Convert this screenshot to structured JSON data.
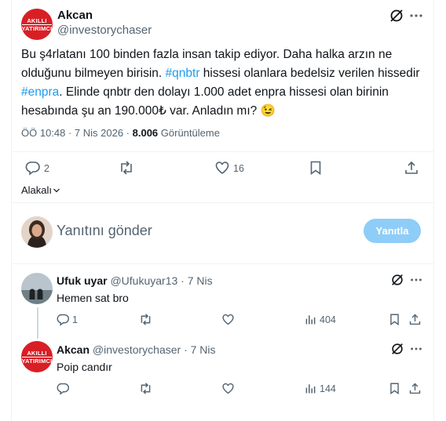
{
  "main_post": {
    "author_name": "Akcan",
    "author_handle": "@investorychaser",
    "avatar_text_1": "AKILLI",
    "avatar_text_2": "YATIRIMCI",
    "text_1": "Bu ş4rlatanı 100 binden fazla insan takip ediyor. Daha halka arzın ne",
    "text_2a": "olduğunu bilmeyen birisin. ",
    "hashtag_1": "#qnbtr",
    "text_2b": " hissesi olanlara bedelsiz verilen hissedir",
    "hashtag_2": "#enpra",
    "text_3b": ". Elinde qnbtr den dolayı 1.000 adet enpra hissesi olan birinin",
    "text_4": "hesabında şu an 190.000₺ var. Anladın mı? 😉",
    "time": "ÖÖ 10:48 · 7 Nis 2026 · ",
    "views_count": "8.006",
    "views_label": " Görüntüleme",
    "reply_count": "2",
    "like_count": "16"
  },
  "translate_label": "Alakalı",
  "composer": {
    "placeholder": "Yanıtını gönder",
    "button_label": "Yanıtla"
  },
  "replies": [
    {
      "name": "Ufuk uyar",
      "handle": "@Ufukuyar13",
      "date": "· 7 Nis",
      "text": "Hemen sat bro",
      "reply_count": "1",
      "views": "404"
    },
    {
      "name": "Akcan",
      "handle": "@investorychaser",
      "date": "· 7 Nis",
      "text": "Poip candır",
      "avatar_text_1": "AKILLI",
      "avatar_text_2": "YATIRIMCI",
      "views": "144"
    }
  ],
  "colors": {
    "accent": "#1d9bf0",
    "logo_red": "#d81f26",
    "muted": "#536471"
  }
}
